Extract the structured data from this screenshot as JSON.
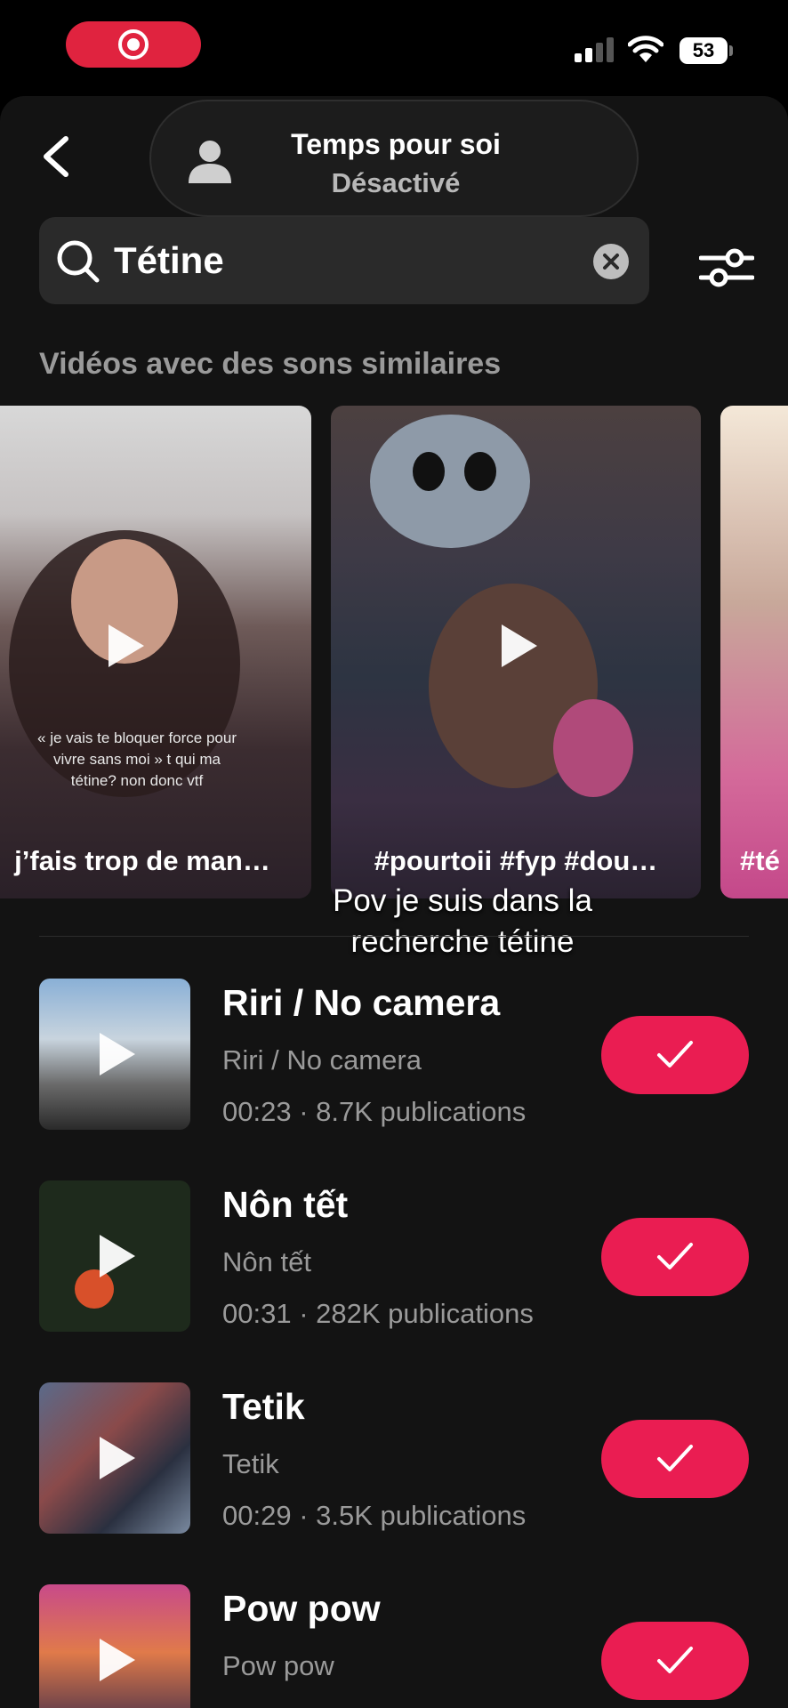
{
  "status_bar": {
    "battery": "53"
  },
  "header": {
    "focus_title": "Temps pour soi",
    "focus_status": "Désactivé"
  },
  "search": {
    "query": "Tétine"
  },
  "section": {
    "title": "Vidéos avec des sons similaires"
  },
  "videos": [
    {
      "title": "j’fais trop de man…",
      "overlay_text": "« je vais te bloquer force pour vivre sans moi » t qui ma tétine? non donc vtf"
    },
    {
      "title": "#pourtoii #fyp #dou…"
    },
    {
      "title": "#té"
    }
  ],
  "overlay_caption": "Pov je suis dans la recherche tétine",
  "songs": [
    {
      "title": "Riri / No camera",
      "artist": "Riri / No camera",
      "meta": "00:23 · 8.7K publications"
    },
    {
      "title": "Nôn tết",
      "artist": "Nôn tết",
      "meta": "00:31 · 282K publications"
    },
    {
      "title": "Tetik",
      "artist": "Tetik",
      "meta": "00:29 · 3.5K publications"
    },
    {
      "title": "Pow pow",
      "artist": "Pow pow",
      "meta": ""
    }
  ],
  "colors": {
    "accent": "#ea1d52",
    "record": "#e0233f",
    "background": "#131313"
  }
}
